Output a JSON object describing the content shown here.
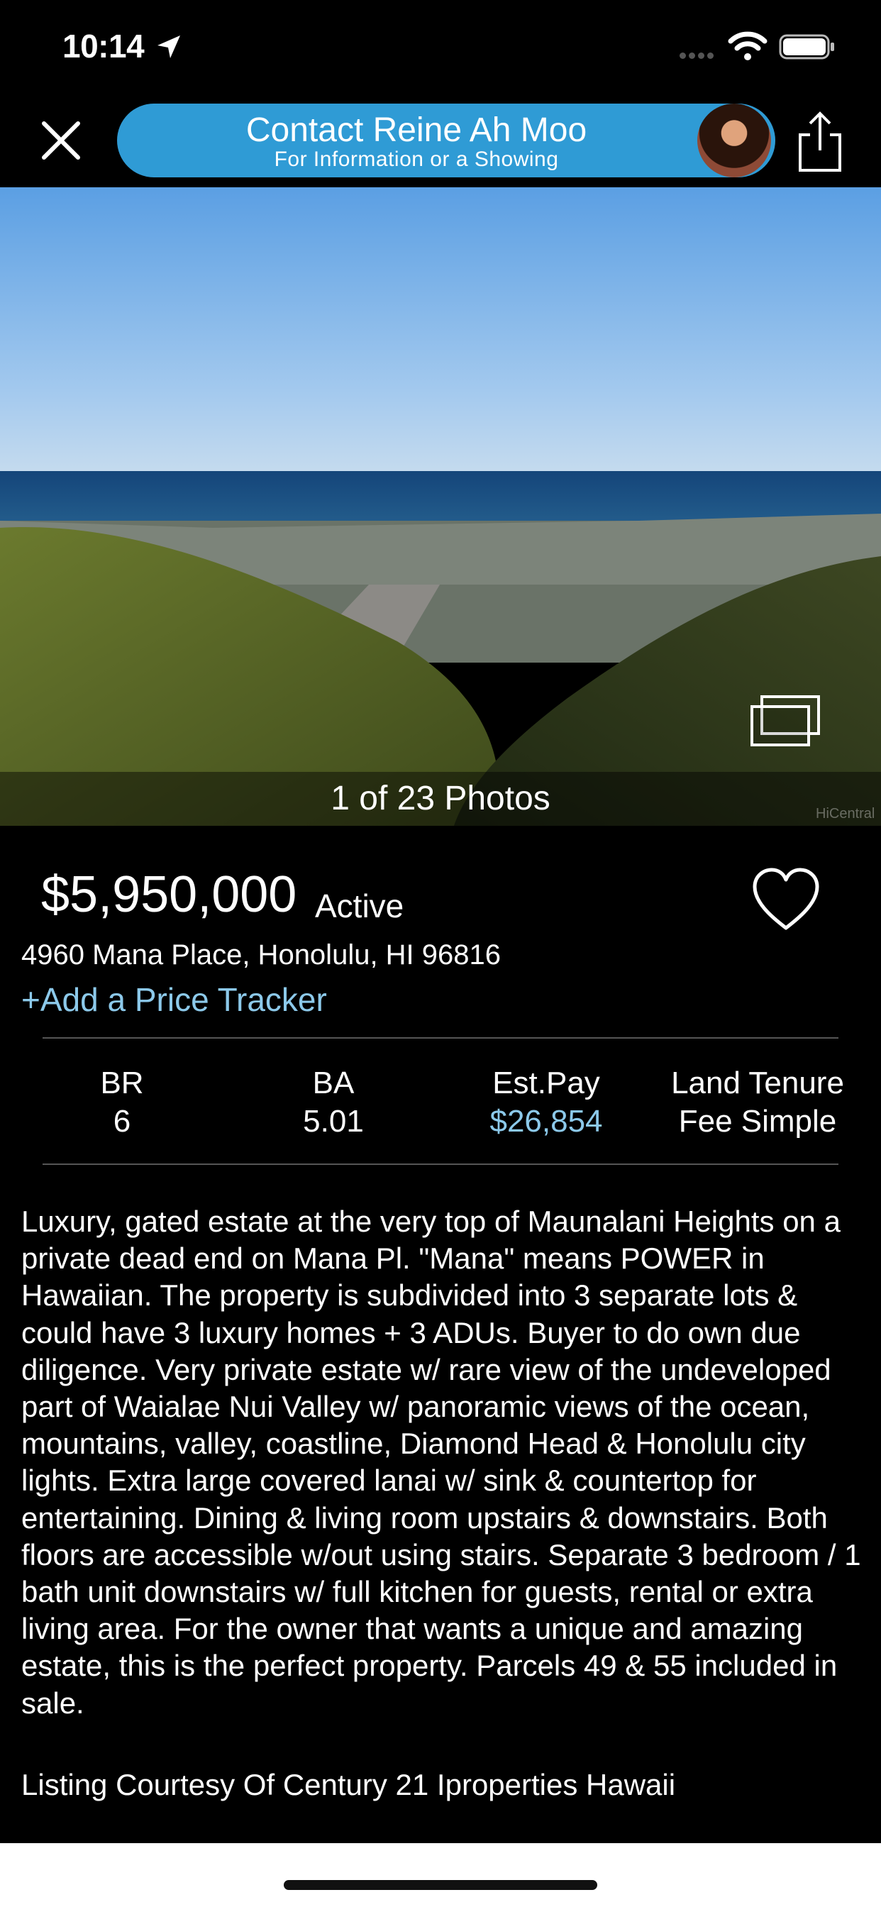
{
  "status_bar": {
    "time": "10:14",
    "icons": [
      "location-arrow-icon",
      "cell-signal-icon",
      "wifi-icon",
      "battery-icon"
    ]
  },
  "header": {
    "close_icon": "close-icon",
    "contact_title": "Contact Reine Ah Moo",
    "contact_subtitle": "For Information or a Showing",
    "share_icon": "share-icon",
    "accent_color": "#2f9bd5"
  },
  "photo": {
    "count_label": "1 of 23 Photos",
    "watermark": "HiCentral",
    "gallery_icon": "gallery-icon"
  },
  "listing": {
    "price": "$5,950,000",
    "status": "Active",
    "address": "4960 Mana Place, Honolulu, HI 96816",
    "tracker_link": "+Add a Price Tracker",
    "favorite_icon": "heart-icon",
    "link_color": "#8cc9ea"
  },
  "stats": {
    "br_label": "BR",
    "br_value": "6",
    "ba_label": "BA",
    "ba_value": "5.01",
    "pay_label": "Est.Pay",
    "pay_value": "$26,854",
    "tenure_label": "Land Tenure",
    "tenure_value": "Fee Simple"
  },
  "description": "Luxury, gated estate at the very top of Maunalani Heights on a private dead end on Mana Pl. \"Mana\" means POWER in Hawaiian. The property is subdivided into 3 separate lots & could have 3 luxury homes + 3 ADUs.  Buyer to do own due diligence. Very private estate w/ rare view of the undeveloped part of Waialae Nui Valley w/ panoramic views of the ocean, mountains, valley, coastline, Diamond Head & Honolulu city lights.  Extra large covered lanai w/ sink & countertop for entertaining.  Dining & living room upstairs & downstairs.  Both floors are accessible w/out using stairs.  Separate 3 bedroom / 1 bath unit downstairs w/ full kitchen for guests, rental or extra living area. For the owner that wants a unique and amazing estate, this is the perfect property. Parcels 49 & 55 included in sale.",
  "courtesy": "Listing Courtesy Of Century 21 Iproperties Hawaii"
}
